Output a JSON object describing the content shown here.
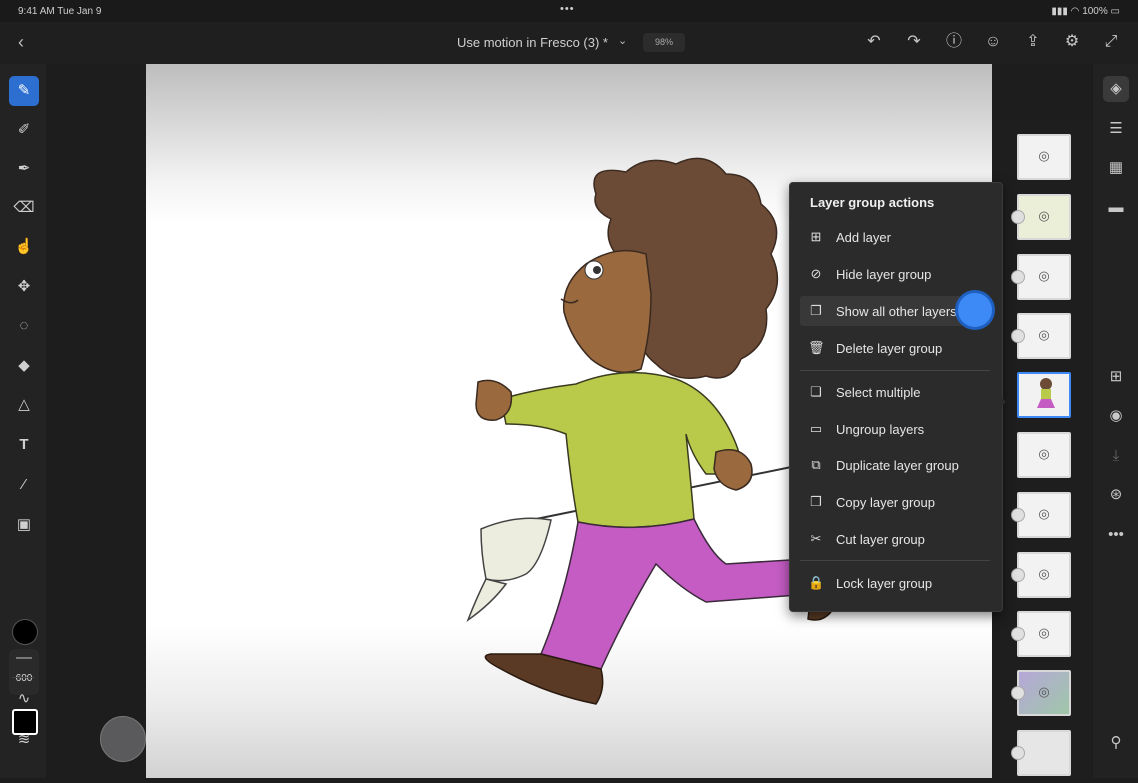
{
  "status": {
    "time_date": "9:41 AM   Tue Jan 9",
    "handle": "•••",
    "battery": "100%"
  },
  "topbar": {
    "doc_title": "Use motion in Fresco (3) *",
    "zoom": "98%"
  },
  "tools": {
    "brush_size": "600"
  },
  "menu": {
    "title": "Layer group actions",
    "items": [
      {
        "label": "Add layer",
        "icon": "add-layer-icon"
      },
      {
        "label": "Hide layer group",
        "icon": "eye-off-icon"
      },
      {
        "label": "Show all other layers",
        "icon": "show-layers-icon"
      },
      {
        "label": "Delete layer group",
        "icon": "trash-icon"
      },
      {
        "label": "Select multiple",
        "icon": "select-multiple-icon"
      },
      {
        "label": "Ungroup layers",
        "icon": "folder-icon"
      },
      {
        "label": "Duplicate layer group",
        "icon": "duplicate-icon"
      },
      {
        "label": "Copy layer group",
        "icon": "copy-icon"
      },
      {
        "label": "Cut layer group",
        "icon": "scissors-icon"
      },
      {
        "label": "Lock layer group",
        "icon": "lock-icon"
      }
    ]
  },
  "colors": {
    "accent": "#3d8af7",
    "menu_bg": "#2b2b2b"
  }
}
